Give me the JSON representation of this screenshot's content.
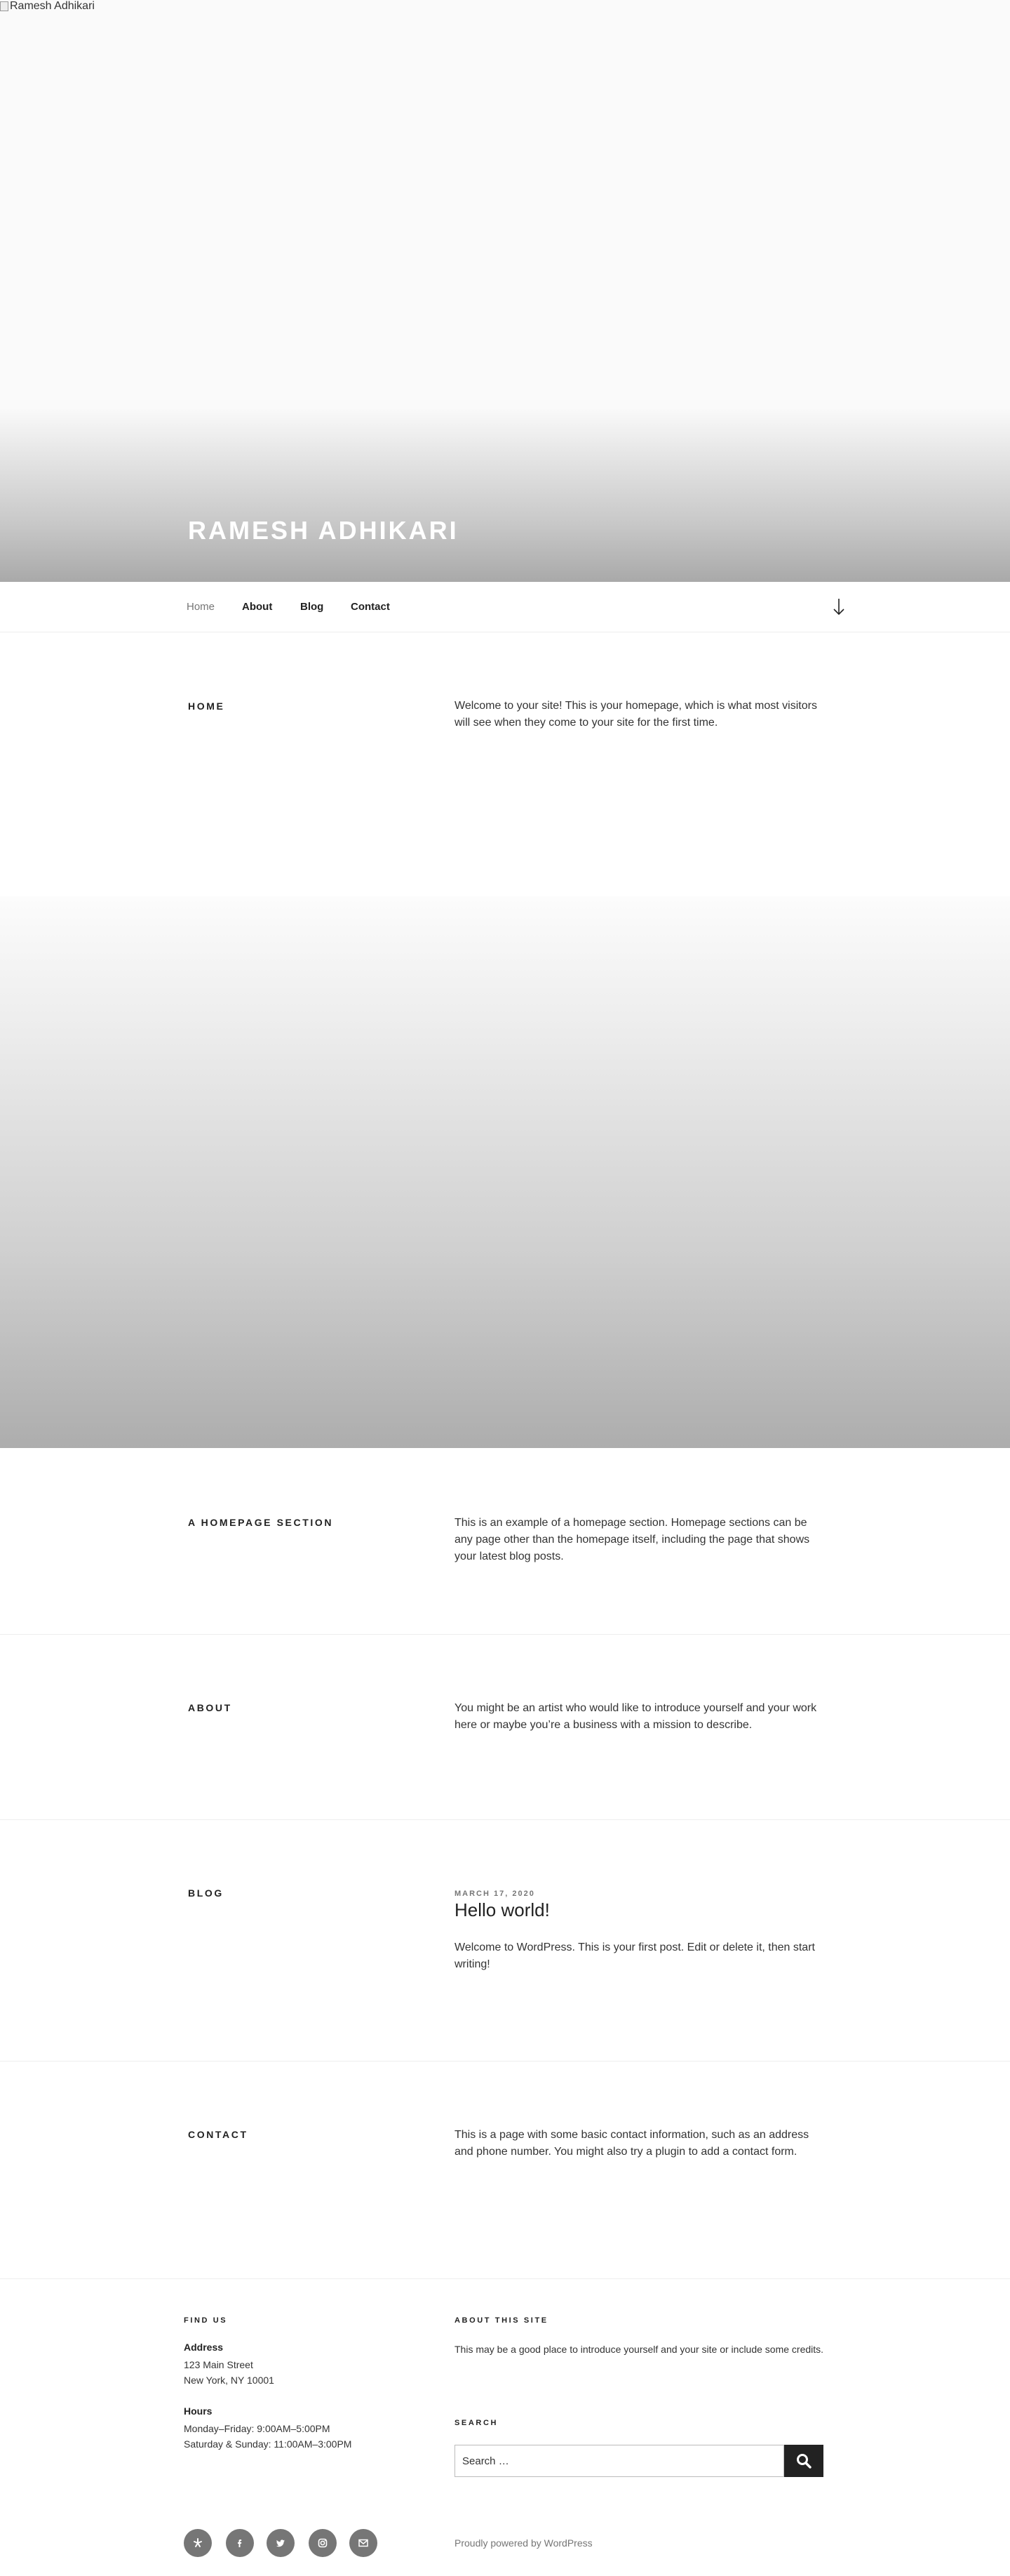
{
  "header": {
    "broken_image_alt": "Ramesh Adhikari",
    "site_title": "RAMESH ADHIKARI"
  },
  "nav": {
    "items": [
      {
        "label": "Home"
      },
      {
        "label": "About"
      },
      {
        "label": "Blog"
      },
      {
        "label": "Contact"
      }
    ],
    "scroll_icon": "arrow-down-icon"
  },
  "sections": {
    "home": {
      "title": "HOME",
      "body": "Welcome to your site! This is your homepage, which is what most visitors will see when they come to your site for the first time."
    },
    "homepage_section": {
      "title": "A HOMEPAGE SECTION",
      "body": "This is an example of a homepage section. Homepage sections can be any page other than the homepage itself, including the page that shows your latest blog posts."
    },
    "about": {
      "title": "ABOUT",
      "body": "You might be an artist who would like to introduce yourself and your work here or maybe you’re a business with a mission to describe."
    },
    "blog": {
      "title": "BLOG",
      "post_date": "MARCH 17, 2020",
      "post_title": "Hello world!",
      "post_excerpt": "Welcome to WordPress. This is your first post. Edit or delete it, then start writing!"
    },
    "contact": {
      "title": "CONTACT",
      "body": "This is a page with some basic contact information, such as an address and phone number. You might also try a plugin to add a contact form."
    }
  },
  "footer": {
    "find_us": {
      "title": "FIND US",
      "address_label": "Address",
      "address_line1": "123 Main Street",
      "address_line2": "New York, NY 10001",
      "hours_label": "Hours",
      "hours_line1": "Monday–Friday: 9:00AM–5:00PM",
      "hours_line2": "Saturday & Sunday: 11:00AM–3:00PM"
    },
    "about_site": {
      "title": "ABOUT THIS SITE",
      "body": "This may be a good place to introduce yourself and your site or include some credits."
    },
    "search": {
      "title": "SEARCH",
      "placeholder": "Search …",
      "button_icon": "search-icon"
    },
    "social_icons": [
      "yelp-icon",
      "facebook-icon",
      "twitter-icon",
      "instagram-icon",
      "email-icon"
    ],
    "powered_by": "Proudly powered by WordPress"
  },
  "colors": {
    "text": "#333333",
    "muted": "#767676",
    "dark": "#222222",
    "title_white": "#ffffff"
  }
}
